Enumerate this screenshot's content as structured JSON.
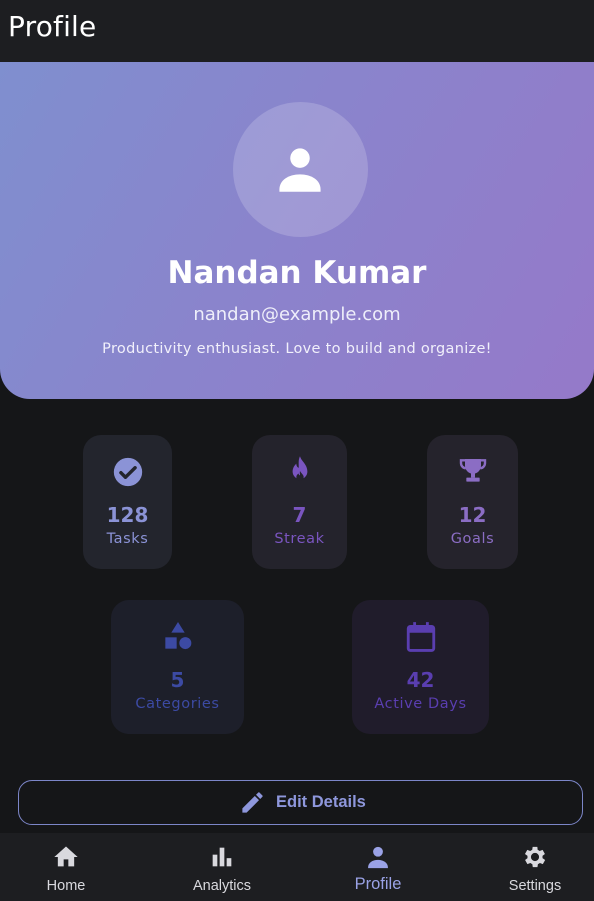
{
  "appbar": {
    "title": "Profile"
  },
  "profile": {
    "name": "Nandan Kumar",
    "email": "nandan@example.com",
    "bio": "Productivity enthusiast. Love to build and organize!"
  },
  "stats": [
    {
      "value": "128",
      "label": "Tasks",
      "icon": "check-circle-icon",
      "color": "#8b93d6"
    },
    {
      "value": "7",
      "label": "Streak",
      "icon": "flame-icon",
      "color": "#7a55c0"
    },
    {
      "value": "12",
      "label": "Goals",
      "icon": "trophy-icon",
      "color": "#8b6dc4"
    },
    {
      "value": "5",
      "label": "Categories",
      "icon": "shapes-icon",
      "color": "#3c4aa3"
    },
    {
      "value": "42",
      "label": "Active Days",
      "icon": "calendar-icon",
      "color": "#5a3eb0"
    }
  ],
  "edit_button": {
    "label": "Edit Details",
    "icon": "pencil-icon"
  },
  "nav": [
    {
      "label": "Home",
      "icon": "home-icon"
    },
    {
      "label": "Analytics",
      "icon": "bar-chart-icon"
    },
    {
      "label": "Profile",
      "icon": "person-icon",
      "active": true
    },
    {
      "label": "Settings",
      "icon": "gear-icon"
    }
  ],
  "colors": {
    "background": "#151618",
    "surface": "#1d1e21",
    "accent": "#8e97dc",
    "hero_gradient_start": "#7f8fcf",
    "hero_gradient_end": "#9579c9"
  }
}
